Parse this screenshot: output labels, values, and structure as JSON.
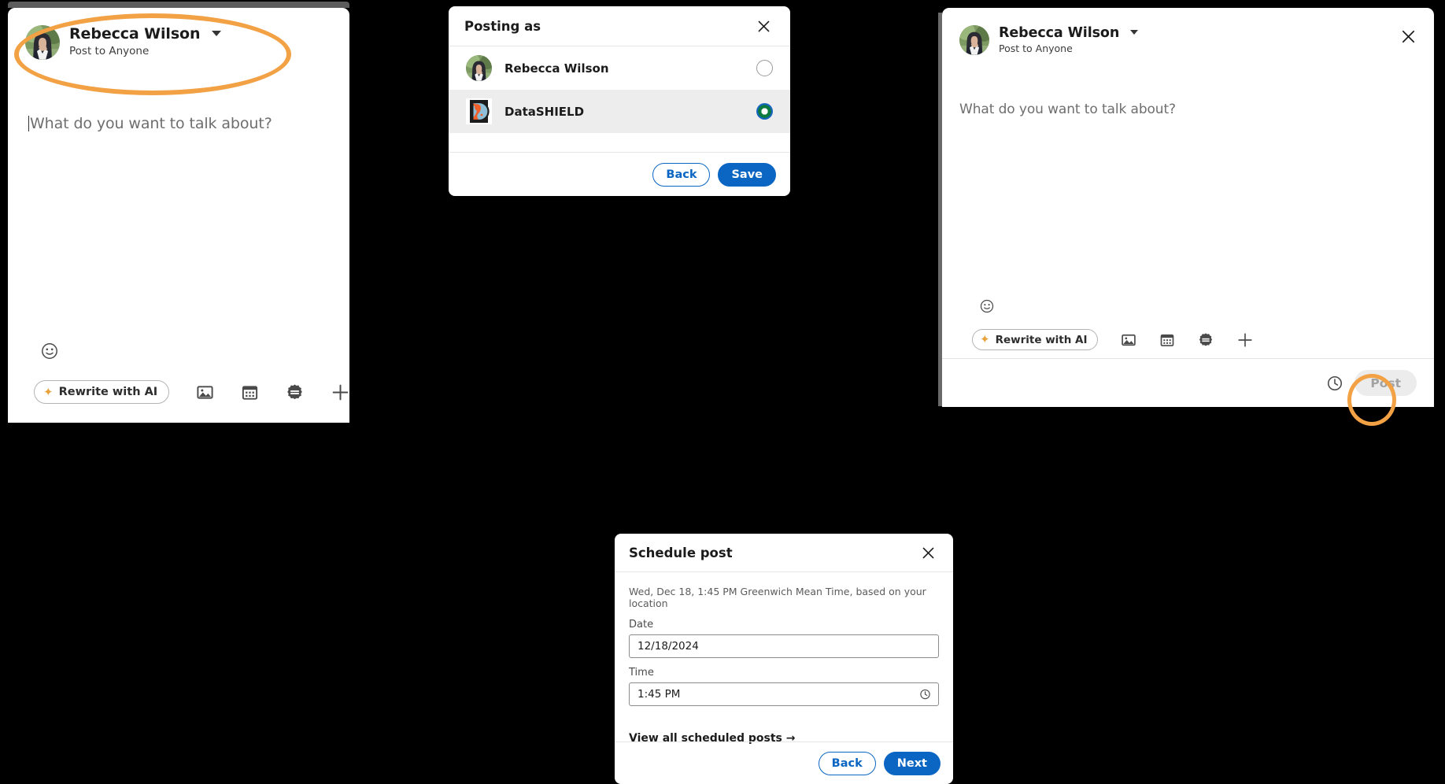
{
  "composer_left": {
    "author": {
      "name": "Rebecca Wilson",
      "audience": "Post to Anyone",
      "avatar_icon": "user-avatar-photo",
      "caret_icon": "chevron-down-icon"
    },
    "placeholder": "What do you want to talk about?",
    "emoji_icon": "emoji-smiley-icon",
    "toolbar": {
      "rewrite_label": "Rewrite with AI",
      "rewrite_icon": "sparkle-icon",
      "media_icon": "image-icon",
      "event_icon": "calendar-icon",
      "celebrate_icon": "celebrate-badge-icon",
      "more_icon": "plus-icon"
    }
  },
  "posting_as_modal": {
    "title": "Posting as",
    "close_icon": "close-icon",
    "options": [
      {
        "label": "Rebecca Wilson",
        "avatar_icon": "user-avatar-photo",
        "selected": false
      },
      {
        "label": "DataSHIELD",
        "avatar_icon": "datashield-logo-icon",
        "selected": true
      }
    ],
    "back_label": "Back",
    "save_label": "Save",
    "selected_radio_color": "#0a7a3e",
    "primary_color": "#0a66c2"
  },
  "composer_right": {
    "author": {
      "name": "Rebecca Wilson",
      "audience": "Post to Anyone",
      "avatar_icon": "user-avatar-photo",
      "caret_icon": "chevron-down-icon"
    },
    "close_icon": "close-icon",
    "placeholder": "What do you want to talk about?",
    "emoji_icon": "emoji-smiley-icon",
    "toolbar": {
      "rewrite_label": "Rewrite with AI",
      "rewrite_icon": "sparkle-icon",
      "media_icon": "image-icon",
      "event_icon": "calendar-icon",
      "celebrate_icon": "celebrate-badge-icon",
      "more_icon": "plus-icon"
    },
    "schedule_icon": "clock-icon",
    "post_label": "Post"
  },
  "schedule_modal": {
    "title": "Schedule post",
    "close_icon": "close-icon",
    "note": "Wed, Dec 18, 1:45 PM Greenwich Mean Time, based on your location",
    "date_label": "Date",
    "date_value": "12/18/2024",
    "time_label": "Time",
    "time_value": "1:45 PM",
    "time_icon": "clock-icon",
    "view_all_label": "View all scheduled posts →",
    "back_label": "Back",
    "next_label": "Next"
  },
  "annotations": {
    "color": "#f2a145",
    "items": [
      {
        "name": "author-selector-highlight"
      },
      {
        "name": "schedule-clock-highlight"
      }
    ]
  }
}
